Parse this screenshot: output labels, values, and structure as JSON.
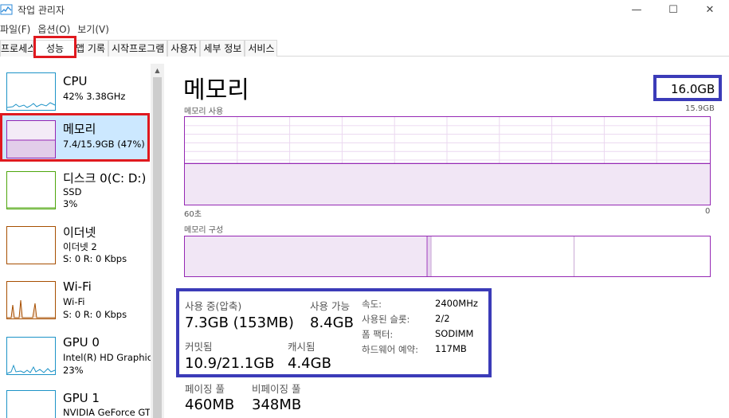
{
  "window": {
    "title": "작업 관리자",
    "controls": {
      "minimize": "—",
      "maximize": "☐",
      "close": "✕"
    }
  },
  "menu": [
    "파일(F)",
    "옵션(O)",
    "보기(V)"
  ],
  "tabs": [
    {
      "label": "프로세스",
      "active": false
    },
    {
      "label": "성능",
      "active": true
    },
    {
      "label": "앱 기록",
      "active": false
    },
    {
      "label": "시작프로그램",
      "active": false
    },
    {
      "label": "사용자",
      "active": false
    },
    {
      "label": "세부 정보",
      "active": false
    },
    {
      "label": "서비스",
      "active": false
    }
  ],
  "sidebar": {
    "items": [
      {
        "title": "CPU",
        "line1": "42% 3.38GHz",
        "line2": "",
        "color": "#1d93c7"
      },
      {
        "title": "메모리",
        "line1": "7.4/15.9GB (47%)",
        "line2": "",
        "color": "#9528b4",
        "selected": true
      },
      {
        "title": "디스크 0(C: D:)",
        "line1": "SSD",
        "line2": "3%",
        "color": "#4da60c"
      },
      {
        "title": "이더넷",
        "line1": "이더넷 2",
        "line2": "S: 0 R: 0 Kbps",
        "color": "#a74f01"
      },
      {
        "title": "Wi-Fi",
        "line1": "Wi-Fi",
        "line2": "S: 0 R: 0 Kbps",
        "color": "#a74f01"
      },
      {
        "title": "GPU 0",
        "line1": "Intel(R) HD Graphic",
        "line2": "23%",
        "color": "#1d93c7"
      },
      {
        "title": "GPU 1",
        "line1": "NVIDIA GeForce GT",
        "line2": "",
        "color": "#1d93c7"
      }
    ]
  },
  "main": {
    "title": "메모리",
    "total": "16.0GB",
    "usage_graph": {
      "label": "메모리 사용",
      "max": "15.9GB",
      "time_left": "60초",
      "time_right": "0",
      "usage_fraction": 0.47
    },
    "composition": {
      "label": "메모리 구성"
    },
    "stats": {
      "in_use_label": "사용 중(압축)",
      "in_use_value": "7.3GB (153MB)",
      "available_label": "사용 가능",
      "available_value": "8.4GB",
      "committed_label": "커밋됨",
      "committed_value": "10.9/21.1GB",
      "cached_label": "캐시됨",
      "cached_value": "4.4GB",
      "paged_pool_label": "페이징 풀",
      "paged_pool_value": "460MB",
      "nonpaged_pool_label": "비페이징 풀",
      "nonpaged_pool_value": "348MB"
    },
    "details": [
      {
        "label": "속도:",
        "value": "2400MHz"
      },
      {
        "label": "사용된 슬롯:",
        "value": "2/2"
      },
      {
        "label": "폼 팩터:",
        "value": "SODIMM"
      },
      {
        "label": "하드웨어 예약:",
        "value": "117MB"
      }
    ]
  },
  "annotations": {
    "red": "#e0191f",
    "blue": "#3b3bb8"
  }
}
